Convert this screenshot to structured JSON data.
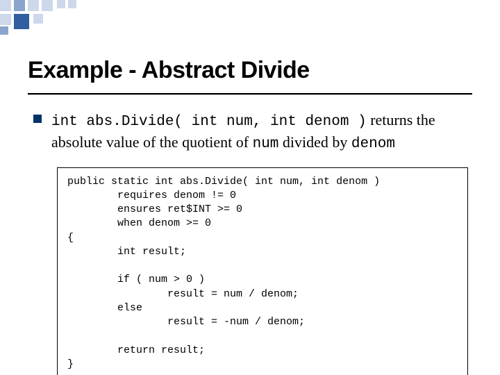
{
  "title": "Example - Abstract Divide",
  "bullet": {
    "sig": "int abs.Divide( int num, int denom )",
    "mid1": " returns the absolute value of the quotient of ",
    "var1": "num",
    "mid2": " divided by ",
    "var2": "denom"
  },
  "code": "public static int abs.Divide( int num, int denom )\n        requires denom != 0\n        ensures ret$INT >= 0\n        when denom >= 0\n{\n        int result;\n\n        if ( num > 0 )\n                result = num / denom;\n        else\n                result = -num / denom;\n\n        return result;\n}",
  "deco": {
    "accent": "#2f5fa0",
    "light": "#cdd8ea",
    "mid": "#8aa4cc"
  }
}
